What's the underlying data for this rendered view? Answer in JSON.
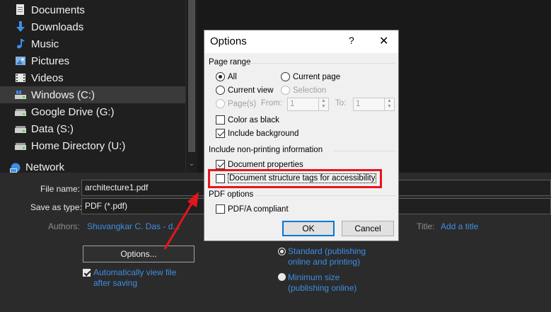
{
  "nav": {
    "items": [
      {
        "label": "Documents",
        "icon": "documents-icon"
      },
      {
        "label": "Downloads",
        "icon": "download-icon"
      },
      {
        "label": "Music",
        "icon": "music-icon"
      },
      {
        "label": "Pictures",
        "icon": "pictures-icon"
      },
      {
        "label": "Videos",
        "icon": "videos-icon"
      },
      {
        "label": "Windows (C:)",
        "icon": "drive-icon",
        "selected": true
      },
      {
        "label": "Google Drive (G:)",
        "icon": "drive-icon"
      },
      {
        "label": "Data (S:)",
        "icon": "drive-icon"
      },
      {
        "label": "Home Directory (U:)",
        "icon": "drive-icon"
      }
    ],
    "network_label": "Network"
  },
  "form": {
    "file_name_label": "File name:",
    "file_name_value": "architecture1.pdf",
    "save_as_type_label": "Save as type:",
    "save_as_type_value": "PDF (*.pdf)",
    "authors_label": "Authors:",
    "authors_value": "Shuvangkar C. Das - d...",
    "title_label": "Title:",
    "title_value": "Add a title",
    "options_button": "Options...",
    "auto_view_label_1": "Automatically view file",
    "auto_view_label_2": "after saving",
    "standard_label_1": "Standard (publishing",
    "standard_label_2": "online and printing)",
    "minimum_label_1": "Minimum size",
    "minimum_label_2": "(publishing online)"
  },
  "dialog": {
    "title": "Options",
    "help": "?",
    "close": "✕",
    "page_range_heading": "Page range",
    "all_label": "All",
    "current_page_label": "Current page",
    "current_view_label": "Current view",
    "selection_label": "Selection",
    "pages_label": "Page(s)",
    "from_label": "From:",
    "from_value": "1",
    "to_label": "To:",
    "to_value": "1",
    "color_black_label": "Color as black",
    "include_background_label": "Include background",
    "nonprinting_heading": "Include non-printing information",
    "doc_properties_label": "Document properties",
    "doc_structure_label": "Document structure tags for accessibility",
    "pdf_options_heading": "PDF options",
    "pdfa_label": "PDF/A compliant",
    "ok_label": "OK",
    "cancel_label": "Cancel"
  },
  "colors": {
    "highlight": "#e8141b",
    "link": "#3d8ee6",
    "accent": "#0078d7"
  }
}
